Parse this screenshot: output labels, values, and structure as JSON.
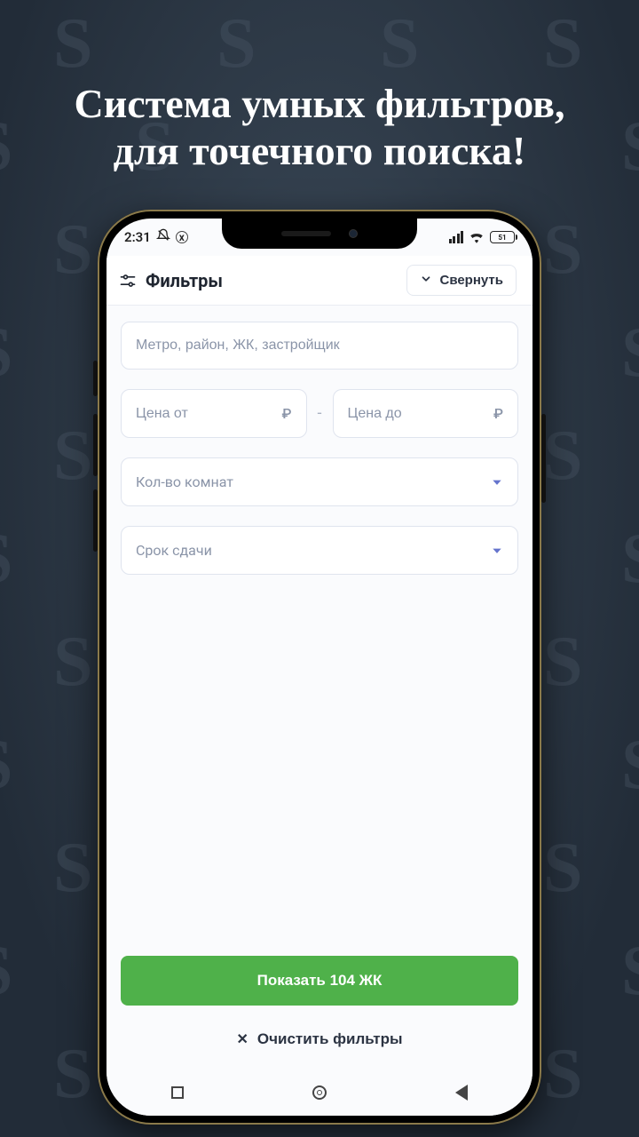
{
  "promo": {
    "headline": "Система умных фильтров, для точечного поиска!"
  },
  "statusbar": {
    "time": "2:31",
    "battery_label": "51"
  },
  "header": {
    "title": "Фильтры",
    "collapse_label": "Свернуть"
  },
  "filters": {
    "search_placeholder": "Метро, район, ЖК, застройщик",
    "price_from_placeholder": "Цена от",
    "price_to_placeholder": "Цена до",
    "currency_symbol": "₽",
    "rooms_label": "Кол-во комнат",
    "deadline_label": "Срок сдачи"
  },
  "actions": {
    "show_label": "Показать 104 ЖК",
    "clear_label": "Очистить фильтры"
  }
}
